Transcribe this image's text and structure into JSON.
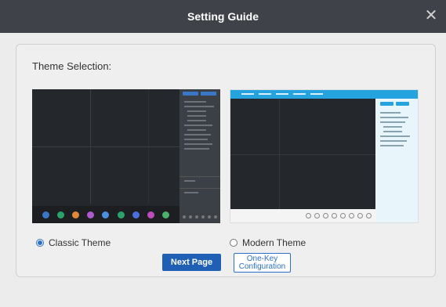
{
  "dialog": {
    "title": "Setting Guide",
    "close_symbol": "✕"
  },
  "section": {
    "heading": "Theme Selection:"
  },
  "themes": [
    {
      "label": "Classic Theme",
      "selected": true
    },
    {
      "label": "Modern Theme",
      "selected": false
    }
  ],
  "footer": {
    "next_label": "Next Page",
    "onekey_label_line1": "One-Key",
    "onekey_label_line2": "Configuration"
  },
  "colors": {
    "titlebar": "#3f4349",
    "primary": "#1f5fb4",
    "modern_accent": "#25a3df",
    "dock_icons": [
      "#3a78c7",
      "#2aa36a",
      "#e0873a",
      "#b05ad0",
      "#4a8fe0",
      "#2aa36a",
      "#4a6fe0",
      "#c04ac0",
      "#4ab06a"
    ]
  },
  "icons": [
    "close-icon"
  ]
}
